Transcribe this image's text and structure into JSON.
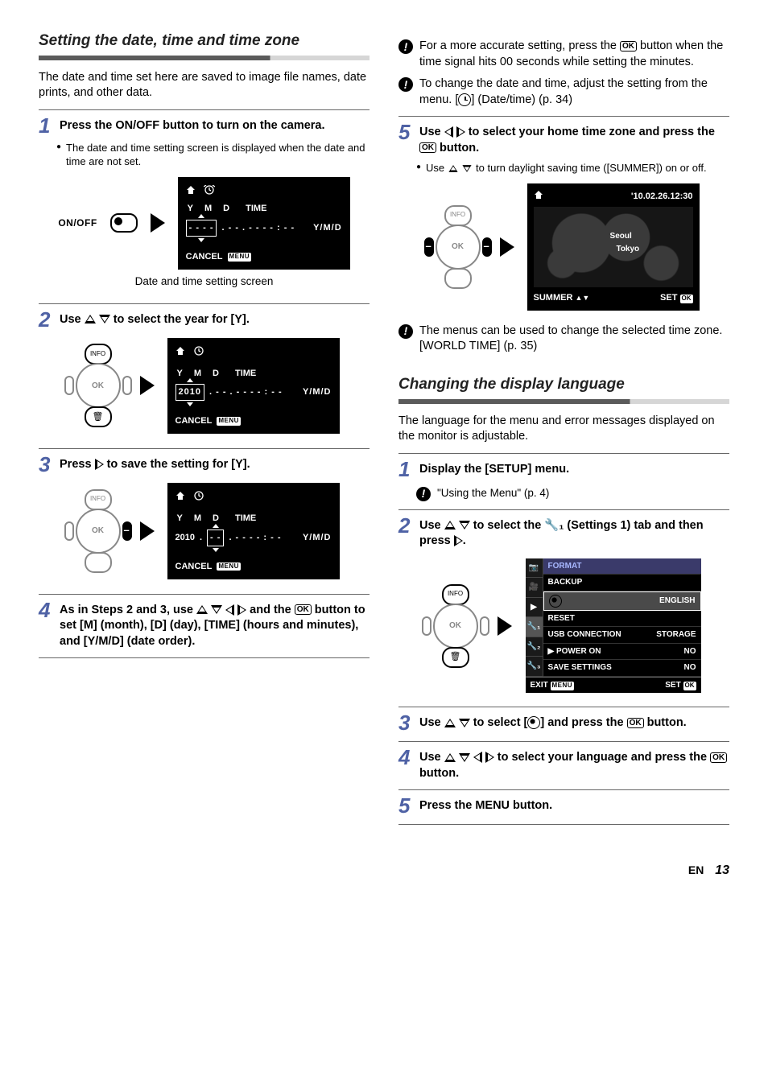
{
  "left": {
    "section_title": "Setting the date, time and time zone",
    "intro": "The date and time set here are saved to image file names, date prints, and other data.",
    "step1": {
      "num": "1",
      "text_a": "Press the ",
      "onoff": "ON/OFF",
      "text_b": " button to turn on the camera.",
      "bullet": "The date and time setting screen is displayed when the date and time are not set.",
      "onoff_label": "ON/OFF",
      "lcd": {
        "hdr_y": "Y",
        "hdr_m": "M",
        "hdr_d": "D",
        "hdr_time": "TIME",
        "year": "- - - -",
        "rest": ". - - . - -   - - : - -",
        "ymd": "Y/M/D",
        "cancel": "CANCEL",
        "menu": "MENU"
      },
      "caption": "Date and time setting screen"
    },
    "step2": {
      "num": "2",
      "text_a": "Use ",
      "text_b": " to select the year for [Y].",
      "lcd": {
        "hdr_y": "Y",
        "hdr_m": "M",
        "hdr_d": "D",
        "hdr_time": "TIME",
        "year": "2010",
        "rest": ". - - . - -   - - : - -",
        "ymd": "Y/M/D",
        "cancel": "CANCEL",
        "menu": "MENU"
      },
      "dpad_ok": "OK",
      "dpad_info": "INFO"
    },
    "step3": {
      "num": "3",
      "text_a": "Press ",
      "text_b": " to save the setting for [Y].",
      "lcd": {
        "hdr_y": "Y",
        "hdr_m": "M",
        "hdr_d": "D",
        "hdr_time": "TIME",
        "year": "2010",
        "month_box": "- -",
        "rest": ". - -   - - : - -",
        "ymd": "Y/M/D",
        "cancel": "CANCEL",
        "menu": "MENU"
      },
      "dpad_ok": "OK",
      "dpad_info": "INFO"
    },
    "step4": {
      "num": "4",
      "text_a": "As in Steps 2 and 3, use ",
      "text_b": " and the ",
      "text_c": " button to set [M] (month), [D] (day), [TIME] (hours and minutes), and [Y/M/D] (date order).",
      "ok": "OK"
    }
  },
  "right": {
    "note1": "For a more accurate setting, press the ",
    "note1_ok": "OK",
    "note1_b": " button when the time signal hits 00 seconds while setting the minutes.",
    "note2_a": "To change the date and time, adjust the setting from the menu. [",
    "note2_b": "] (Date/time) (p. 34)",
    "step5": {
      "num": "5",
      "text_a": "Use ",
      "text_b": " to select your home time zone and press the ",
      "text_c": " button.",
      "ok": "OK",
      "bullet_a": "Use ",
      "bullet_b": " to turn daylight saving time ([SUMMER]) on or off.",
      "lcd": {
        "stamp": "'10.02.26.12:30",
        "city1": "Seoul",
        "city2": "Tokyo",
        "summer": "SUMMER",
        "set": "SET",
        "ok": "OK"
      },
      "dpad_ok": "OK",
      "dpad_info": "INFO"
    },
    "note3": "The menus can be used to change the selected time zone. [WORLD TIME] (p. 35)",
    "section2_title": "Changing the display language",
    "section2_intro": "The language for the menu and error messages displayed on the monitor is adjustable.",
    "s2_step1": {
      "num": "1",
      "text": "Display the [SETUP] menu.",
      "note": "\"Using the Menu\" (p. 4)"
    },
    "s2_step2": {
      "num": "2",
      "text_a": "Use ",
      "text_b": " to select the ",
      "text_c": " (Settings 1) tab and then press ",
      "text_d": ".",
      "dpad_ok": "OK",
      "dpad_info": "INFO",
      "menu": {
        "format": "FORMAT",
        "backup": "BACKUP",
        "english": "ENGLISH",
        "reset": "RESET",
        "usb": "USB CONNECTION",
        "usb_v": "STORAGE",
        "pwr": "POWER ON",
        "pwr_v": "NO",
        "save": "SAVE SETTINGS",
        "save_v": "NO",
        "exit": "EXIT",
        "menu_lbl": "MENU",
        "set": "SET",
        "ok": "OK"
      }
    },
    "s2_step3": {
      "num": "3",
      "text_a": "Use ",
      "text_b": " to select [",
      "text_c": "] and press the ",
      "text_d": " button.",
      "ok": "OK"
    },
    "s2_step4": {
      "num": "4",
      "text_a": "Use ",
      "text_b": " to select your language and press the ",
      "text_c": " button.",
      "ok": "OK"
    },
    "s2_step5": {
      "num": "5",
      "text_a": "Press the ",
      "menu": "MENU",
      "text_b": " button."
    }
  },
  "footer": {
    "en": "EN",
    "page": "13"
  }
}
